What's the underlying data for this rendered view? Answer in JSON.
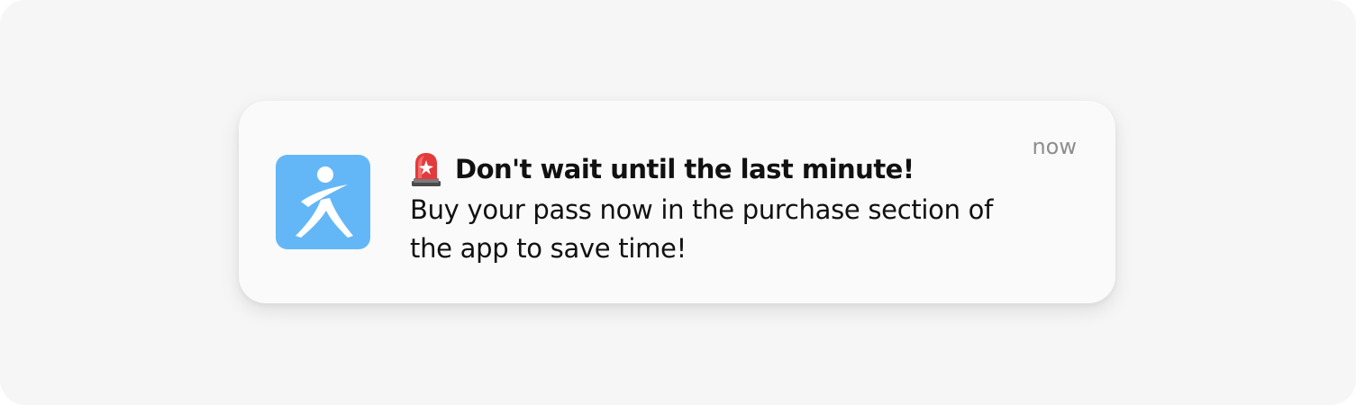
{
  "notification": {
    "app_name": "app-icon",
    "timestamp": "now",
    "title_icon": "rotating-light-icon",
    "title": "Don't wait until the last minute!",
    "body": "Buy your pass now in the purchase section of the app to save time!"
  },
  "colors": {
    "background": "#f6f6f6",
    "card": "#fafafa",
    "app_icon_bg": "#63b7f7",
    "timestamp": "#8e8e8e",
    "text": "#111111"
  }
}
